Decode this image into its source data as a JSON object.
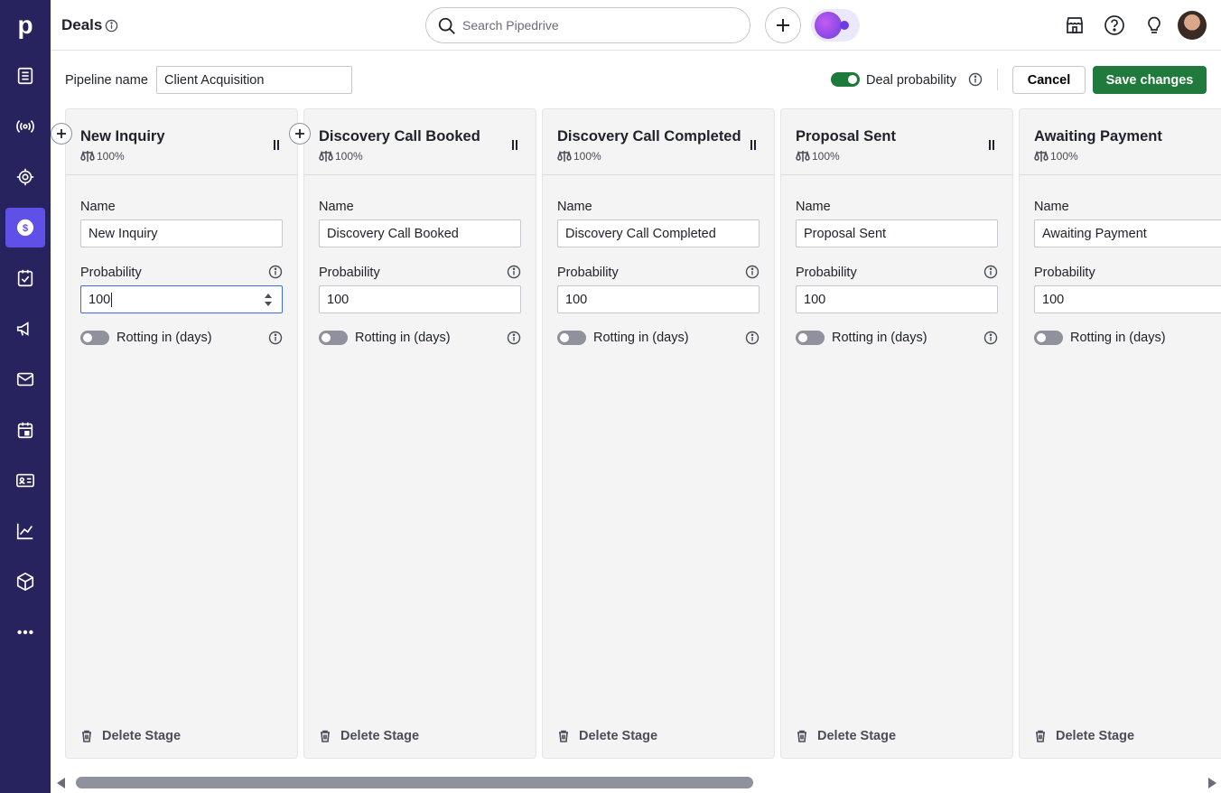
{
  "app": {
    "logo_letter": "p",
    "page_title": "Deals"
  },
  "nav": {
    "items": [
      {
        "name": "leads-icon",
        "active": false
      },
      {
        "name": "radar-icon",
        "active": false
      },
      {
        "name": "target-icon",
        "active": false
      },
      {
        "name": "deals-icon",
        "active": true
      },
      {
        "name": "activities-icon",
        "active": false
      },
      {
        "name": "campaigns-icon",
        "active": false
      },
      {
        "name": "mail-icon",
        "active": false
      },
      {
        "name": "calendar-icon",
        "active": false
      },
      {
        "name": "contacts-icon",
        "active": false
      },
      {
        "name": "insights-icon",
        "active": false
      },
      {
        "name": "products-icon",
        "active": false
      },
      {
        "name": "more-icon",
        "active": false
      }
    ]
  },
  "search": {
    "placeholder": "Search Pipedrive"
  },
  "pipeline": {
    "label": "Pipeline name",
    "value": "Client Acquisition",
    "deal_probability_label": "Deal probability",
    "deal_probability_enabled": true,
    "cancel_label": "Cancel",
    "save_label": "Save changes"
  },
  "stage_labels": {
    "name": "Name",
    "probability": "Probability",
    "rotting": "Rotting in (days)",
    "delete": "Delete Stage"
  },
  "stages": [
    {
      "title": "New Inquiry",
      "prob_badge": "100%",
      "name_value": "New Inquiry",
      "probability_value": "100",
      "rotting_enabled": false
    },
    {
      "title": "Discovery Call Booked",
      "prob_badge": "100%",
      "name_value": "Discovery Call Booked",
      "probability_value": "100",
      "rotting_enabled": false
    },
    {
      "title": "Discovery Call Completed",
      "prob_badge": "100%",
      "name_value": "Discovery Call Completed",
      "probability_value": "100",
      "rotting_enabled": false
    },
    {
      "title": "Proposal Sent",
      "prob_badge": "100%",
      "name_value": "Proposal Sent",
      "probability_value": "100",
      "rotting_enabled": false
    },
    {
      "title": "Awaiting Payment",
      "prob_badge": "100%",
      "name_value": "Awaiting Payment",
      "probability_value": "100",
      "rotting_enabled": false
    }
  ],
  "colors": {
    "rail": "#26235f",
    "active_nav": "#5f50e8",
    "save": "#1f7a3c",
    "toggle_on": "#1c7a3a"
  }
}
